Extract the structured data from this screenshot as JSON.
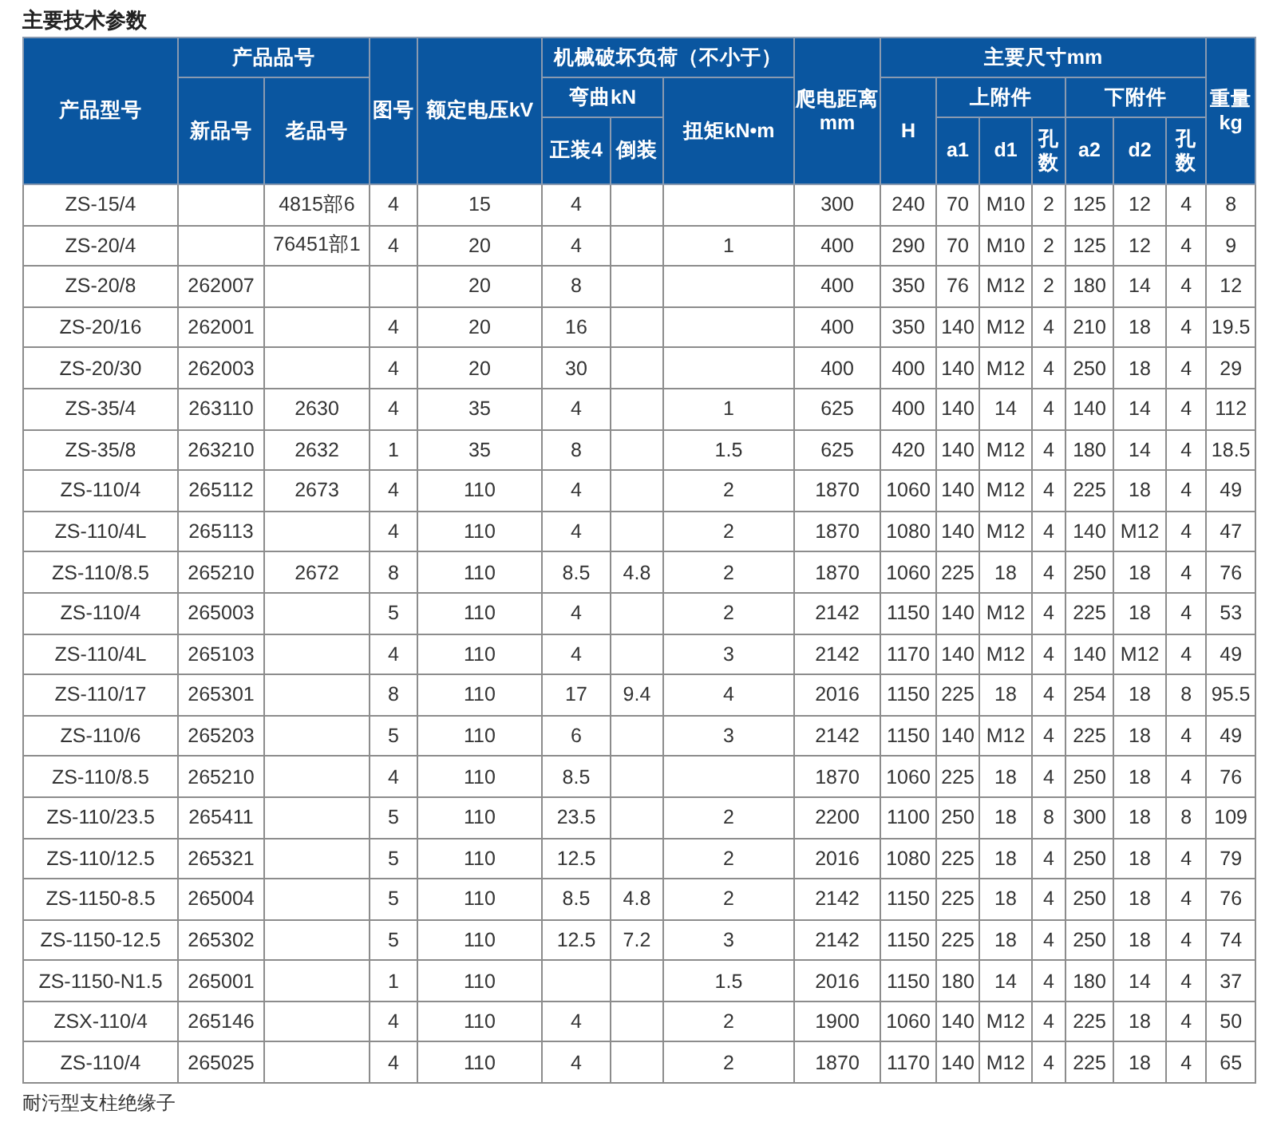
{
  "title": "主要技术参数",
  "table": {
    "header": [
      [
        {
          "text": "产品型号",
          "rowspan": 3
        },
        {
          "text": "产品品号",
          "colspan": 2
        },
        {
          "text": "图号",
          "rowspan": 3
        },
        {
          "text": "额定电压kV",
          "rowspan": 3
        },
        {
          "text": "机械破坏负荷（不小于）",
          "colspan": 3
        },
        {
          "text": "爬电距离mm",
          "rowspan": 3
        },
        {
          "text": "主要尺寸mm",
          "colspan": 7
        },
        {
          "text": "重量kg",
          "rowspan": 3
        }
      ],
      [
        {
          "text": "新品号",
          "rowspan": 2
        },
        {
          "text": "老品号",
          "rowspan": 2
        },
        {
          "text": "弯曲kN",
          "colspan": 2
        },
        {
          "text": "扭矩kN•m",
          "rowspan": 2
        },
        {
          "text": "H",
          "rowspan": 2
        },
        {
          "text": "上附件",
          "colspan": 3
        },
        {
          "text": "下附件",
          "colspan": 3
        }
      ],
      [
        {
          "text": "正装4"
        },
        {
          "text": "倒装"
        },
        {
          "text": "a1"
        },
        {
          "text": "d1"
        },
        {
          "text": "孔数"
        },
        {
          "text": "a2"
        },
        {
          "text": "d2"
        },
        {
          "text": "孔数"
        }
      ]
    ],
    "rows": [
      [
        "ZS-15/4",
        null,
        "4815部6",
        "4",
        "15",
        "4",
        null,
        null,
        "300",
        "240",
        "70",
        "M10",
        "2",
        "125",
        "12",
        "4",
        "8"
      ],
      [
        "ZS-20/4",
        null,
        "76451部1",
        "4",
        "20",
        "4",
        null,
        "1",
        "400",
        "290",
        "70",
        "M10",
        "2",
        "125",
        "12",
        "4",
        "9"
      ],
      [
        "ZS-20/8",
        "262007",
        null,
        null,
        "20",
        "8",
        null,
        null,
        "400",
        "350",
        "76",
        "M12",
        "2",
        "180",
        "14",
        "4",
        "12"
      ],
      [
        "ZS-20/16",
        "262001",
        null,
        "4",
        "20",
        "16",
        null,
        null,
        "400",
        "350",
        "140",
        "M12",
        "4",
        "210",
        "18",
        "4",
        "19.5"
      ],
      [
        "ZS-20/30",
        "262003",
        null,
        "4",
        "20",
        "30",
        null,
        null,
        "400",
        "400",
        "140",
        "M12",
        "4",
        "250",
        "18",
        "4",
        "29"
      ],
      [
        "ZS-35/4",
        "263110",
        "2630",
        "4",
        "35",
        "4",
        null,
        "1",
        "625",
        "400",
        "140",
        "14",
        "4",
        "140",
        "14",
        "4",
        "112"
      ],
      [
        "ZS-35/8",
        "263210",
        "2632",
        "1",
        "35",
        "8",
        null,
        "1.5",
        "625",
        "420",
        "140",
        "M12",
        "4",
        "180",
        "14",
        "4",
        "18.5"
      ],
      [
        "ZS-110/4",
        "265112",
        "2673",
        "4",
        "110",
        "4",
        null,
        "2",
        "1870",
        "1060",
        "140",
        "M12",
        "4",
        "225",
        "18",
        "4",
        "49"
      ],
      [
        "ZS-110/4L",
        "265113",
        null,
        "4",
        "110",
        "4",
        null,
        "2",
        "1870",
        "1080",
        "140",
        "M12",
        "4",
        "140",
        "M12",
        "4",
        "47"
      ],
      [
        "ZS-110/8.5",
        "265210",
        "2672",
        "8",
        "110",
        "8.5",
        "4.8",
        "2",
        "1870",
        "1060",
        "225",
        "18",
        "4",
        "250",
        "18",
        "4",
        "76"
      ],
      [
        "ZS-110/4",
        "265003",
        null,
        "5",
        "110",
        "4",
        null,
        "2",
        "2142",
        "1150",
        "140",
        "M12",
        "4",
        "225",
        "18",
        "4",
        "53"
      ],
      [
        "ZS-110/4L",
        "265103",
        null,
        "4",
        "110",
        "4",
        null,
        "3",
        "2142",
        "1170",
        "140",
        "M12",
        "4",
        "140",
        "M12",
        "4",
        "49"
      ],
      [
        "ZS-110/17",
        "265301",
        null,
        "8",
        "110",
        "17",
        "9.4",
        "4",
        "2016",
        "1150",
        "225",
        "18",
        "4",
        "254",
        "18",
        "8",
        "95.5"
      ],
      [
        "ZS-110/6",
        "265203",
        null,
        "5",
        "110",
        "6",
        null,
        "3",
        "2142",
        "1150",
        "140",
        "M12",
        "4",
        "225",
        "18",
        "4",
        "49"
      ],
      [
        "ZS-110/8.5",
        "265210",
        null,
        "4",
        "110",
        "8.5",
        null,
        null,
        "1870",
        "1060",
        "225",
        "18",
        "4",
        "250",
        "18",
        "4",
        "76"
      ],
      [
        "ZS-110/23.5",
        "265411",
        null,
        "5",
        "110",
        "23.5",
        null,
        "2",
        "2200",
        "1100",
        "250",
        "18",
        "8",
        "300",
        "18",
        "8",
        "109"
      ],
      [
        "ZS-110/12.5",
        "265321",
        null,
        "5",
        "110",
        "12.5",
        null,
        "2",
        "2016",
        "1080",
        "225",
        "18",
        "4",
        "250",
        "18",
        "4",
        "79"
      ],
      [
        "ZS-1150-8.5",
        "265004",
        null,
        "5",
        "110",
        "8.5",
        "4.8",
        "2",
        "2142",
        "1150",
        "225",
        "18",
        "4",
        "250",
        "18",
        "4",
        "76"
      ],
      [
        "ZS-1150-12.5",
        "265302",
        null,
        "5",
        "110",
        "12.5",
        "7.2",
        "3",
        "2142",
        "1150",
        "225",
        "18",
        "4",
        "250",
        "18",
        "4",
        "74"
      ],
      [
        "ZS-1150-N1.5",
        "265001",
        null,
        "1",
        "110",
        null,
        null,
        "1.5",
        "2016",
        "1150",
        "180",
        "14",
        "4",
        "180",
        "14",
        "4",
        "37"
      ],
      [
        "ZSX-110/4",
        "265146",
        null,
        "4",
        "110",
        "4",
        null,
        "2",
        "1900",
        "1060",
        "140",
        "M12",
        "4",
        "225",
        "18",
        "4",
        "50"
      ],
      [
        "ZS-110/4",
        "265025",
        null,
        "4",
        "110",
        "4",
        null,
        "2",
        "1870",
        "1170",
        "140",
        "M12",
        "4",
        "225",
        "18",
        "4",
        "65"
      ]
    ]
  },
  "caption": "耐污型支柱绝缘子"
}
